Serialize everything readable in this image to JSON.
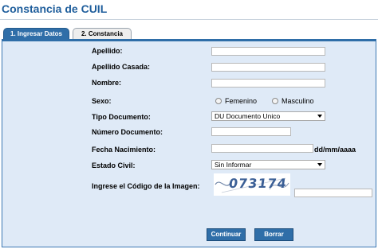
{
  "page": {
    "title": "Constancia de CUIL"
  },
  "tabs": [
    {
      "label": "1. Ingresar Datos",
      "active": true
    },
    {
      "label": "2. Constancia",
      "active": false
    }
  ],
  "form": {
    "apellido_label": "Apellido:",
    "apellido_casada_label": "Apellido Casada:",
    "nombre_label": "Nombre:",
    "sexo_label": "Sexo:",
    "sexo_options": [
      "Femenino",
      "Masculino"
    ],
    "tipo_documento_label": "Tipo Documento:",
    "tipo_documento_value": "DU Documento Unico",
    "numero_documento_label": "Número Documento:",
    "fecha_nacimiento_label": "Fecha Nacimiento:",
    "fecha_format_hint": "dd/mm/aaaa",
    "estado_civil_label": "Estado Civil:",
    "estado_civil_value": "Sin Informar",
    "captcha_label": "Ingrese el Código de la Imagen:",
    "captcha_text": "073174"
  },
  "buttons": {
    "continuar": "Continuar",
    "borrar": "Borrar"
  },
  "colors": {
    "title": "#1f5e9c",
    "tab_active": "#2f6ea8",
    "panel_bg": "#dfeaf7",
    "button": "#2f6ea8"
  }
}
